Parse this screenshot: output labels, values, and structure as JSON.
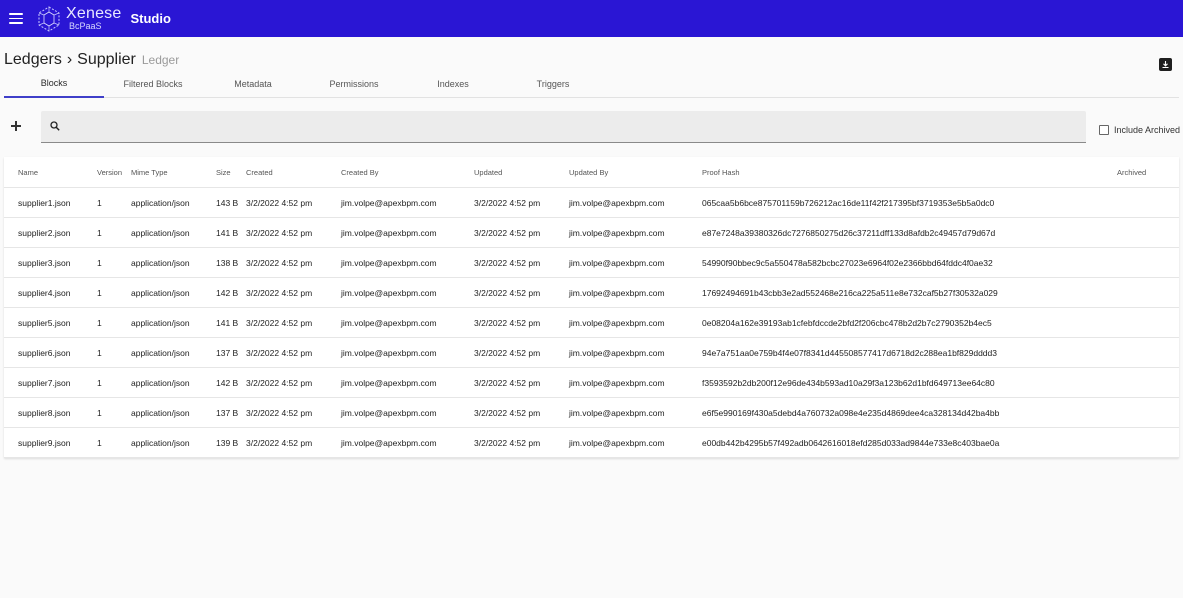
{
  "app": {
    "brand_name": "Xenese",
    "brand_sub": "BcPaaS",
    "studio": "Studio",
    "accent_color": "#2a16d4"
  },
  "breadcrumb": {
    "parent": "Ledgers",
    "separator": "›",
    "current": "Supplier",
    "type": "Ledger"
  },
  "tabs": [
    {
      "label": "Blocks",
      "active": true
    },
    {
      "label": "Filtered Blocks",
      "active": false
    },
    {
      "label": "Metadata",
      "active": false
    },
    {
      "label": "Permissions",
      "active": false
    },
    {
      "label": "Indexes",
      "active": false
    },
    {
      "label": "Triggers",
      "active": false
    }
  ],
  "search": {
    "value": "",
    "placeholder": ""
  },
  "archived_toggle": {
    "label": "Include Archived",
    "checked": false
  },
  "table": {
    "headers": {
      "name": "Name",
      "version": "Version",
      "mime": "Mime Type",
      "size": "Size",
      "created": "Created",
      "created_by": "Created By",
      "updated": "Updated",
      "updated_by": "Updated By",
      "hash": "Proof Hash",
      "archived": "Archived"
    },
    "rows": [
      {
        "name": "supplier1.json",
        "version": "1",
        "mime": "application/json",
        "size": "143 B",
        "created": "3/2/2022 4:52 pm",
        "created_by": "jim.volpe@apexbpm.com",
        "updated": "3/2/2022 4:52 pm",
        "updated_by": "jim.volpe@apexbpm.com",
        "hash": "065caa5b6bce875701159b726212ac16de11f42f217395bf3719353e5b5a0dc0",
        "archived": ""
      },
      {
        "name": "supplier2.json",
        "version": "1",
        "mime": "application/json",
        "size": "141 B",
        "created": "3/2/2022 4:52 pm",
        "created_by": "jim.volpe@apexbpm.com",
        "updated": "3/2/2022 4:52 pm",
        "updated_by": "jim.volpe@apexbpm.com",
        "hash": "e87e7248a39380326dc7276850275d26c37211dff133d8afdb2c49457d79d67d",
        "archived": ""
      },
      {
        "name": "supplier3.json",
        "version": "1",
        "mime": "application/json",
        "size": "138 B",
        "created": "3/2/2022 4:52 pm",
        "created_by": "jim.volpe@apexbpm.com",
        "updated": "3/2/2022 4:52 pm",
        "updated_by": "jim.volpe@apexbpm.com",
        "hash": "54990f90bbec9c5a550478a582bcbc27023e6964f02e2366bbd64fddc4f0ae32",
        "archived": ""
      },
      {
        "name": "supplier4.json",
        "version": "1",
        "mime": "application/json",
        "size": "142 B",
        "created": "3/2/2022 4:52 pm",
        "created_by": "jim.volpe@apexbpm.com",
        "updated": "3/2/2022 4:52 pm",
        "updated_by": "jim.volpe@apexbpm.com",
        "hash": "17692494691b43cbb3e2ad552468e216ca225a511e8e732caf5b27f30532a029",
        "archived": ""
      },
      {
        "name": "supplier5.json",
        "version": "1",
        "mime": "application/json",
        "size": "141 B",
        "created": "3/2/2022 4:52 pm",
        "created_by": "jim.volpe@apexbpm.com",
        "updated": "3/2/2022 4:52 pm",
        "updated_by": "jim.volpe@apexbpm.com",
        "hash": "0e08204a162e39193ab1cfebfdccde2bfd2f206cbc478b2d2b7c2790352b4ec5",
        "archived": ""
      },
      {
        "name": "supplier6.json",
        "version": "1",
        "mime": "application/json",
        "size": "137 B",
        "created": "3/2/2022 4:52 pm",
        "created_by": "jim.volpe@apexbpm.com",
        "updated": "3/2/2022 4:52 pm",
        "updated_by": "jim.volpe@apexbpm.com",
        "hash": "94e7a751aa0e759b4f4e07f8341d445508577417d6718d2c288ea1bf829dddd3",
        "archived": ""
      },
      {
        "name": "supplier7.json",
        "version": "1",
        "mime": "application/json",
        "size": "142 B",
        "created": "3/2/2022 4:52 pm",
        "created_by": "jim.volpe@apexbpm.com",
        "updated": "3/2/2022 4:52 pm",
        "updated_by": "jim.volpe@apexbpm.com",
        "hash": "f3593592b2db200f12e96de434b593ad10a29f3a123b62d1bfd649713ee64c80",
        "archived": ""
      },
      {
        "name": "supplier8.json",
        "version": "1",
        "mime": "application/json",
        "size": "137 B",
        "created": "3/2/2022 4:52 pm",
        "created_by": "jim.volpe@apexbpm.com",
        "updated": "3/2/2022 4:52 pm",
        "updated_by": "jim.volpe@apexbpm.com",
        "hash": "e6f5e990169f430a5debd4a760732a098e4e235d4869dee4ca328134d42ba4bb",
        "archived": ""
      },
      {
        "name": "supplier9.json",
        "version": "1",
        "mime": "application/json",
        "size": "139 B",
        "created": "3/2/2022 4:52 pm",
        "created_by": "jim.volpe@apexbpm.com",
        "updated": "3/2/2022 4:52 pm",
        "updated_by": "jim.volpe@apexbpm.com",
        "hash": "e00db442b4295b57f492adb0642616018efd285d033ad9844e733e8c403bae0a",
        "archived": ""
      }
    ]
  }
}
